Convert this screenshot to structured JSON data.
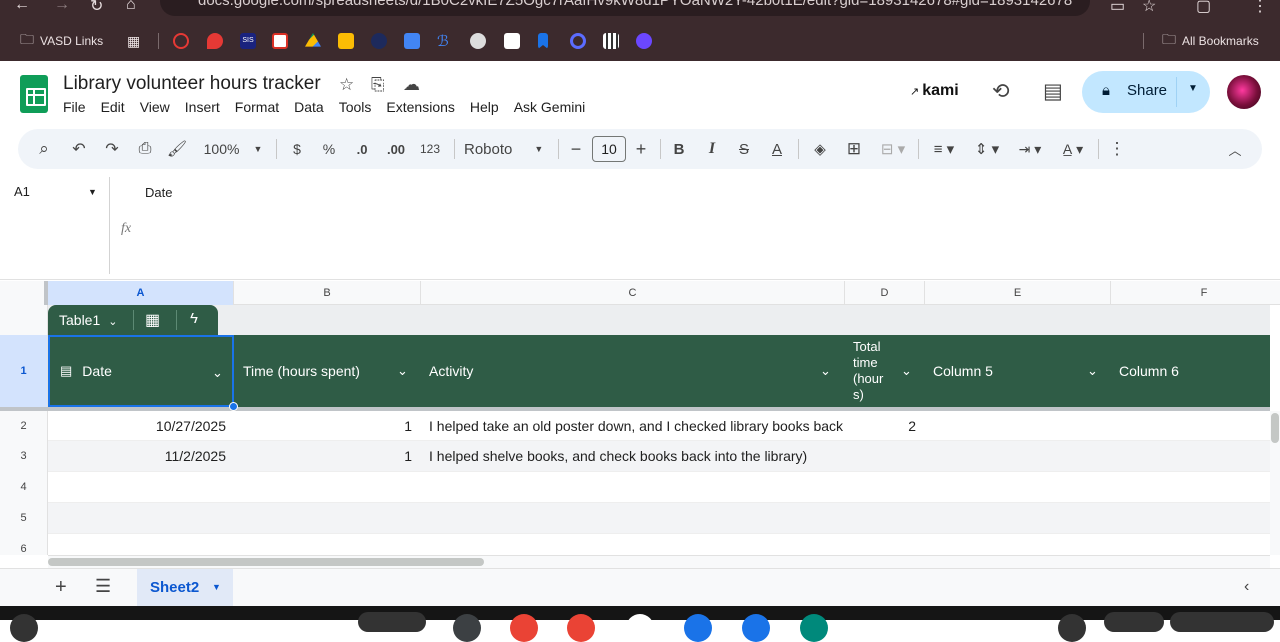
{
  "browser": {
    "url": "docs.google.com/spreadsheets/d/1B0C2vkIE7Z5Ogc7rAafHv9kW8d1PYOaNW2Y-42b0t1E/edit?gid=1893142678#gid=1893142678",
    "bookmarks": {
      "vasd": "VASD Links",
      "all": "All Bookmarks"
    }
  },
  "doc": {
    "title": "Library volunteer hours tracker",
    "menu": [
      "File",
      "Edit",
      "View",
      "Insert",
      "Format",
      "Data",
      "Tools",
      "Extensions",
      "Help",
      "Ask Gemini"
    ],
    "kami": "kami",
    "share": "Share"
  },
  "toolbar": {
    "zoom": "100%",
    "font": "Roboto",
    "font_size": "10",
    "currency": "$",
    "percent": "%",
    "dec_dec": ".0",
    "dec_inc": ".00",
    "number_format": "123"
  },
  "formula_bar": {
    "cell_ref": "A1",
    "value": "Date",
    "fx": "fx"
  },
  "columns": [
    "A",
    "B",
    "C",
    "D",
    "E",
    "F"
  ],
  "table": {
    "name": "Table1",
    "headers": [
      "Date",
      "Time (hours spent)",
      "Activity",
      "Total time (hours)",
      "Column 5",
      "Column 6"
    ],
    "header_d_lines": [
      "Total",
      "time",
      "(hour",
      "s)"
    ],
    "rows": [
      {
        "date": "10/27/2025",
        "time": "1",
        "activity": "I helped take an old poster down, and I checked library books back ir",
        "total": "2"
      },
      {
        "date": "11/2/2025",
        "time": "1",
        "activity": "I helped shelve books, and check books back into the library)",
        "total": ""
      }
    ]
  },
  "row_numbers": [
    "1",
    "2",
    "3",
    "4",
    "5",
    "6"
  ],
  "sheet_tab": "Sheet2",
  "colors": {
    "table_header": "#2f5c46",
    "share_bg": "#c2e7ff",
    "sheets_green": "#0f9d58",
    "selection": "#1a73e8"
  }
}
